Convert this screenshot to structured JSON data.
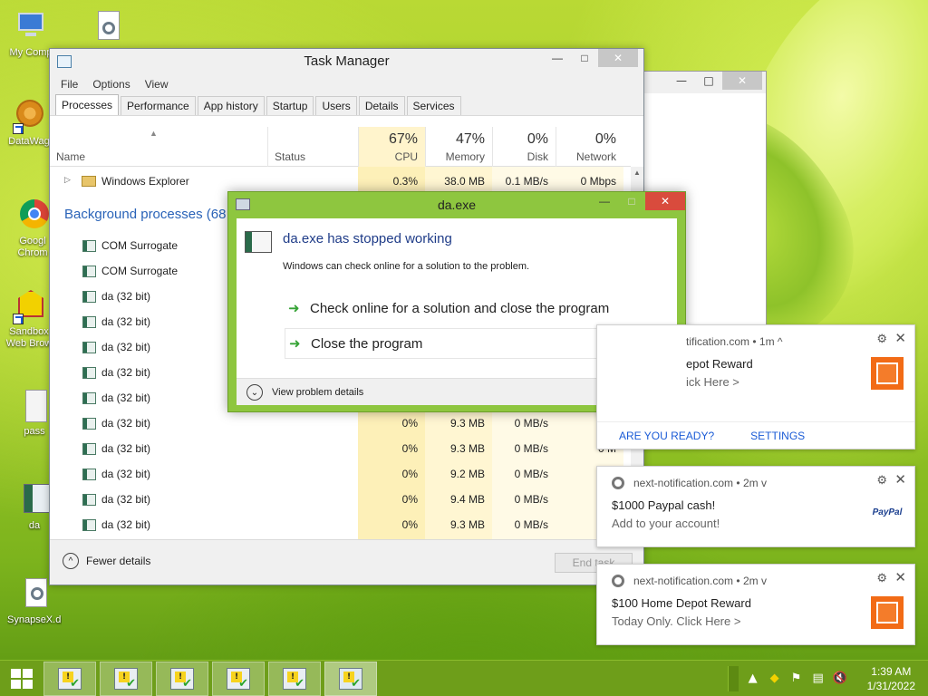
{
  "desktop": {
    "icons": [
      {
        "label": "My Comp",
        "icon": "computer-icon"
      },
      {
        "label": "",
        "icon": "settings-file-icon"
      },
      {
        "label": "DataWag",
        "icon": "datawag-icon"
      },
      {
        "label": "Googl Chrom",
        "icon": "chrome-icon"
      },
      {
        "label": "Sandbox Web Brow",
        "icon": "sandbox-icon"
      },
      {
        "label": "pass",
        "icon": "text-file-icon"
      },
      {
        "label": "da",
        "icon": "app-icon"
      },
      {
        "label": "SynapseX.dll",
        "icon": "dll-icon"
      }
    ]
  },
  "task_manager": {
    "title": "Task Manager",
    "menu": [
      "File",
      "Options",
      "View"
    ],
    "tabs": [
      "Processes",
      "Performance",
      "App history",
      "Startup",
      "Users",
      "Details",
      "Services"
    ],
    "active_tab": "Processes",
    "columns": {
      "name": "Name",
      "status": "Status",
      "cpu": {
        "pct": "67%",
        "label": "CPU"
      },
      "memory": {
        "pct": "47%",
        "label": "Memory"
      },
      "disk": {
        "pct": "0%",
        "label": "Disk"
      },
      "network": {
        "pct": "0%",
        "label": "Network"
      }
    },
    "app_rows": [
      {
        "name": "Windows Explorer",
        "cpu": "0.3%",
        "memory": "38.0 MB",
        "disk": "0.1 MB/s",
        "network": "0 Mbps"
      }
    ],
    "group_header": "Background processes (68",
    "bg_rows": [
      {
        "name": "COM Surrogate",
        "cpu": "",
        "memory": "",
        "disk": "",
        "network": ""
      },
      {
        "name": "COM Surrogate",
        "cpu": "",
        "memory": "",
        "disk": "",
        "network": ""
      },
      {
        "name": "da (32 bit)",
        "cpu": "",
        "memory": "",
        "disk": "",
        "network": ""
      },
      {
        "name": "da (32 bit)",
        "cpu": "",
        "memory": "",
        "disk": "",
        "network": ""
      },
      {
        "name": "da (32 bit)",
        "cpu": "",
        "memory": "",
        "disk": "",
        "network": ""
      },
      {
        "name": "da (32 bit)",
        "cpu": "",
        "memory": "",
        "disk": "",
        "network": ""
      },
      {
        "name": "da (32 bit)",
        "cpu": "",
        "memory": "",
        "disk": "",
        "network": ""
      },
      {
        "name": "da (32 bit)",
        "cpu": "0%",
        "memory": "9.3 MB",
        "disk": "0 MB/s",
        "network": "0 M"
      },
      {
        "name": "da (32 bit)",
        "cpu": "0%",
        "memory": "9.3 MB",
        "disk": "0 MB/s",
        "network": "0 M"
      },
      {
        "name": "da (32 bit)",
        "cpu": "0%",
        "memory": "9.2 MB",
        "disk": "0 MB/s",
        "network": "0 M"
      },
      {
        "name": "da (32 bit)",
        "cpu": "0%",
        "memory": "9.4 MB",
        "disk": "0 MB/s",
        "network": "0 M"
      },
      {
        "name": "da (32 bit)",
        "cpu": "0%",
        "memory": "9.3 MB",
        "disk": "0 MB/s",
        "network": "0 M"
      }
    ],
    "fewer_details": "Fewer details",
    "end_task": "End task"
  },
  "dialog": {
    "title": "da.exe",
    "heading": "da.exe has stopped working",
    "subtext": "Windows can check online for a solution to the problem.",
    "option1": "Check online for a solution and close the program",
    "option2": "Close the program",
    "details": "View problem details"
  },
  "notifications": [
    {
      "source": "tification.com",
      "time": "1m",
      "chevron": "^",
      "line1": "epot Reward",
      "line2": "ick Here >",
      "logo": "home-depot-logo",
      "actions": [
        "ARE YOU READY?",
        "SETTINGS"
      ]
    },
    {
      "source": "next-notification.com",
      "time": "2m",
      "chevron": "v",
      "line1": "$1000 Paypal cash!",
      "line2": "Add to your account!",
      "logo": "paypal-logo",
      "logo_text": "PayPal"
    },
    {
      "source": "next-notification.com",
      "time": "2m",
      "chevron": "v",
      "line1": "$100 Home Depot Reward",
      "line2": "Today Only. Click Here >",
      "logo": "home-depot-logo"
    }
  ],
  "taskbar": {
    "items_count_label": "",
    "clock": {
      "time": "1:39 AM",
      "date": "1/31/2022"
    }
  },
  "colors": {
    "dialog_frame": "#8ec63f",
    "taskbar": "#6e9e1a",
    "link_blue": "#1a5bd6",
    "heading_blue": "#1f3c88"
  }
}
